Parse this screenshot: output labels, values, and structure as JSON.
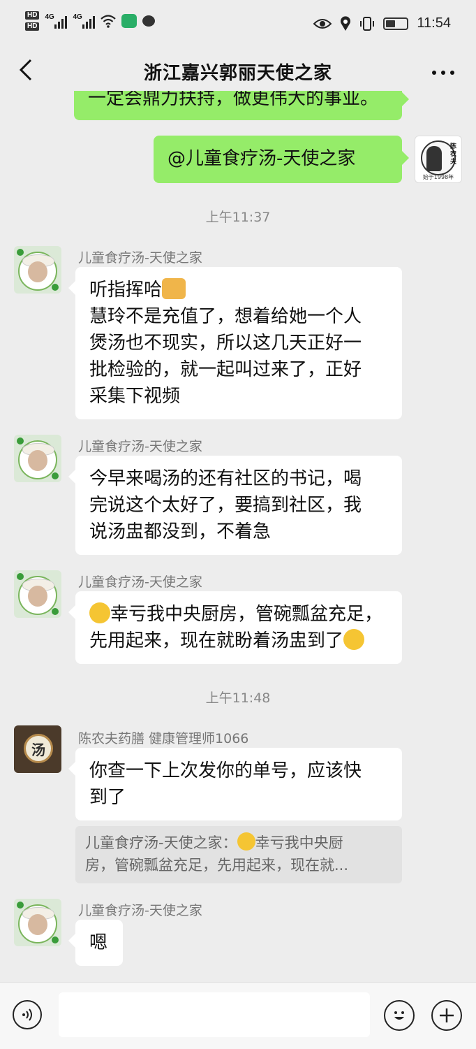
{
  "status_bar": {
    "time": "11:54",
    "left_labels": [
      "HD",
      "HD"
    ],
    "network": [
      "4G",
      "4G"
    ]
  },
  "nav": {
    "title": "浙江嘉兴郭丽天使之家",
    "back_icon": "chevron-left-icon",
    "more_icon": "more-icon"
  },
  "messages": {
    "partial_top": "一定会鼎力扶持，做更伟大的事业。",
    "mine_mention": "@儿童食疗汤-天使之家",
    "my_avatar_text": "陈农夫",
    "my_avatar_footer": "始于1998年",
    "timestamp1": "上午11:37",
    "m1": {
      "sender": "儿童食疗汤-天使之家",
      "lines": [
        "听指挥哈",
        "慧玲不是充值了，想着给她一个人",
        "煲汤也不现实，所以这几天正好一",
        "批检验的，就一起叫过来了，正好",
        "采集下视频"
      ]
    },
    "m2": {
      "sender": "儿童食疗汤-天使之家",
      "lines": [
        "今早来喝汤的还有社区的书记，喝",
        "完说这个太好了，要搞到社区，我",
        "说汤盅都没到，不着急"
      ]
    },
    "m3": {
      "sender": "儿童食疗汤-天使之家",
      "lines": [
        "幸亏我中央厨房，管碗瓢盆充足，",
        "先用起来，现在就盼着汤盅到了"
      ]
    },
    "timestamp2": "上午11:48",
    "m4": {
      "sender": "陈农夫药膳   健康管理师1066",
      "avatar_text": "汤",
      "lines": [
        "你查一下上次发你的单号，应该快",
        "到了"
      ],
      "quote_lines": [
        "儿童食疗汤-天使之家：",
        "幸亏我中央厨",
        "房，管碗瓢盆充足，先用起来，现在就..."
      ]
    },
    "m5": {
      "sender": "儿童食疗汤-天使之家",
      "text": "嗯"
    }
  },
  "input_bar": {
    "voice_icon": "voice-icon",
    "emoji_icon": "emoji-icon",
    "plus_icon": "plus-icon"
  }
}
